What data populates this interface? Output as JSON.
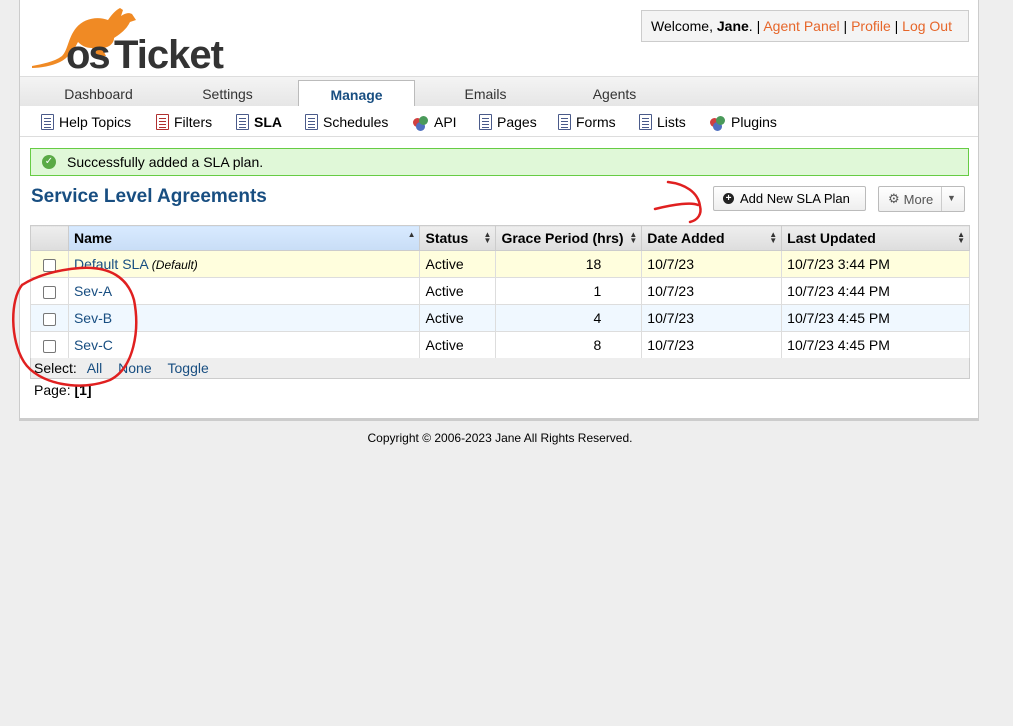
{
  "logo": {
    "text_os": "os",
    "text_ticket": "Ticket"
  },
  "userbox": {
    "welcome_prefix": "Welcome, ",
    "user_name": "Jane",
    "welcome_suffix": ". ",
    "sep": "|",
    "agent_panel": "Agent Panel",
    "profile": "Profile",
    "logout": "Log Out"
  },
  "nav": {
    "tabs": [
      {
        "label": "Dashboard"
      },
      {
        "label": "Settings"
      },
      {
        "label": "Manage"
      },
      {
        "label": "Emails"
      },
      {
        "label": "Agents"
      }
    ],
    "active": "Manage"
  },
  "subnav": {
    "items": [
      {
        "label": "Help Topics",
        "icon": "help-topics-icon"
      },
      {
        "label": "Filters",
        "icon": "filters-icon"
      },
      {
        "label": "SLA",
        "icon": "sla-icon"
      },
      {
        "label": "Schedules",
        "icon": "schedules-icon"
      },
      {
        "label": "API",
        "icon": "api-icon"
      },
      {
        "label": "Pages",
        "icon": "pages-icon"
      },
      {
        "label": "Forms",
        "icon": "forms-icon"
      },
      {
        "label": "Lists",
        "icon": "lists-icon"
      },
      {
        "label": "Plugins",
        "icon": "plugins-icon"
      }
    ],
    "active": "SLA"
  },
  "alert": {
    "message": "Successfully added a SLA plan."
  },
  "page": {
    "title": "Service Level Agreements",
    "add_button": "Add New SLA Plan",
    "more_button": "More"
  },
  "table": {
    "columns": [
      "Name",
      "Status",
      "Grace Period (hrs)",
      "Date Added",
      "Last Updated"
    ],
    "rows": [
      {
        "name": "Default SLA",
        "tag": "(Default)",
        "status": "Active",
        "grace": "18",
        "added": "10/7/23",
        "updated": "10/7/23 3:44 PM"
      },
      {
        "name": "Sev-A",
        "tag": "",
        "status": "Active",
        "grace": "1",
        "added": "10/7/23",
        "updated": "10/7/23 4:44 PM"
      },
      {
        "name": "Sev-B",
        "tag": "",
        "status": "Active",
        "grace": "4",
        "added": "10/7/23",
        "updated": "10/7/23 4:45 PM"
      },
      {
        "name": "Sev-C",
        "tag": "",
        "status": "Active",
        "grace": "8",
        "added": "10/7/23",
        "updated": "10/7/23 4:45 PM"
      }
    ]
  },
  "select_bar": {
    "label": "Select:",
    "all": "All",
    "none": "None",
    "toggle": "Toggle"
  },
  "pager": {
    "label": "Page:",
    "current": "[1]"
  },
  "footer": {
    "copyright": "Copyright © 2006-2023 Jane All Rights Reserved."
  },
  "colors": {
    "accent": "#184e81",
    "brand_orange": "#f08a24",
    "link_orange": "#e6662a",
    "success_bg": "#e0f8d8",
    "annotation_red": "#e02020"
  }
}
